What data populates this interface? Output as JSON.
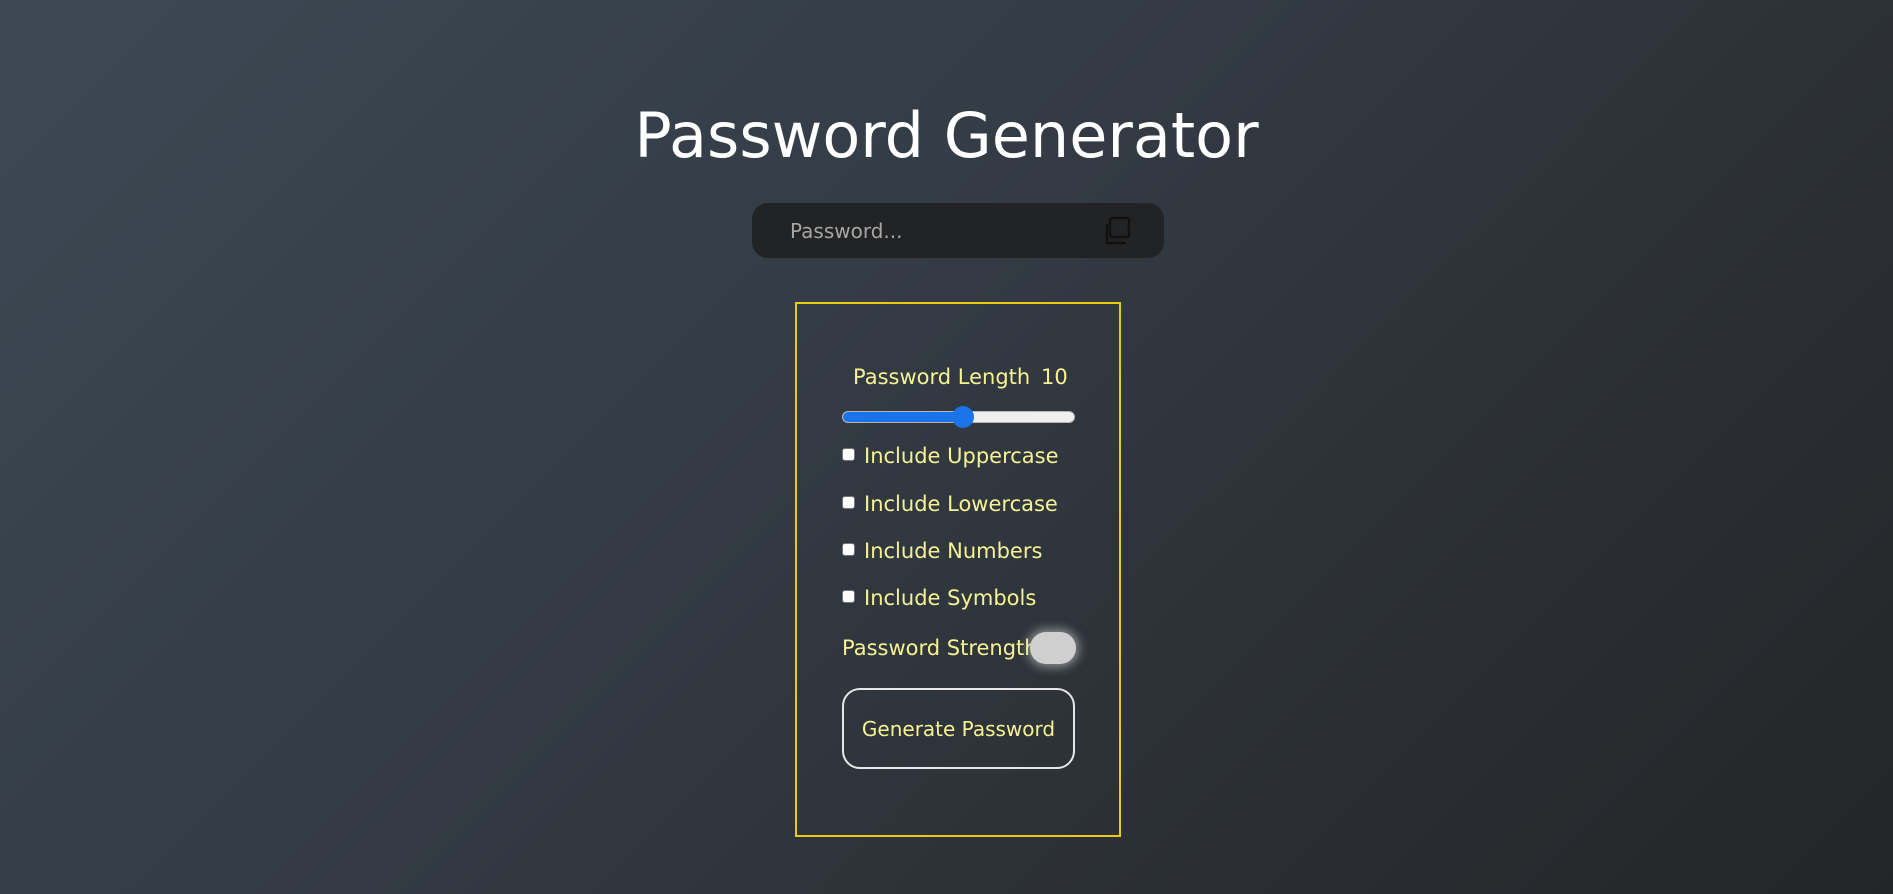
{
  "header": {
    "title": "Password Generator"
  },
  "password": {
    "placeholder": "Password...",
    "value": "",
    "copy_icon": "copy-icon"
  },
  "settings": {
    "length_label": "Password Length",
    "length_value": "10",
    "slider": {
      "value": 10,
      "fraction": 0.52
    },
    "options": [
      {
        "label": "Include Uppercase",
        "checked": false
      },
      {
        "label": "Include Lowercase",
        "checked": false
      },
      {
        "label": "Include Numbers",
        "checked": false
      },
      {
        "label": "Include Symbols",
        "checked": false
      }
    ],
    "strength_label": "Password Strength",
    "strength_color": "#cfcfcf",
    "generate_label": "Generate Password"
  },
  "colors": {
    "accent_text": "#f6f294",
    "panel_border": "#e9cb14",
    "slider_accent": "#1a73e8"
  }
}
